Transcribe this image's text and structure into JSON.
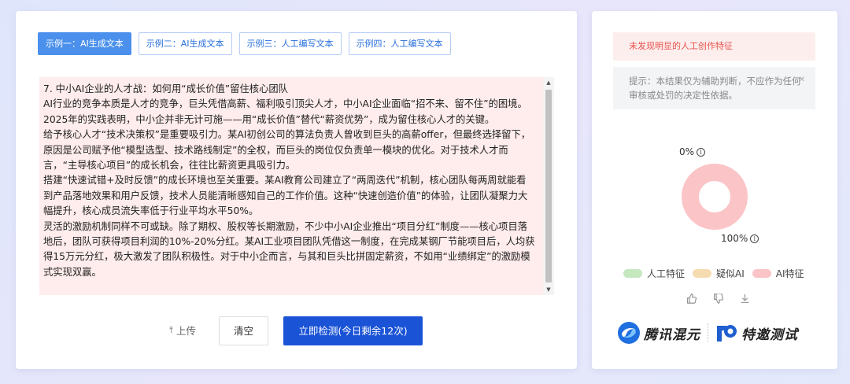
{
  "tabs": [
    {
      "label": "示例一：AI生成文本",
      "active": true
    },
    {
      "label": "示例二：AI生成文本",
      "active": false
    },
    {
      "label": "示例三：人工编写文本",
      "active": false
    },
    {
      "label": "示例四：人工编写文本",
      "active": false
    }
  ],
  "textarea": {
    "content": "7. 中小AI企业的人才战：如何用“成长价值”留住核心团队\nAI行业的竞争本质是人才的竞争，巨头凭借高薪、福利吸引顶尖人才，中小AI企业面临“招不来、留不住”的困境。2025年的实践表明，中小企并非无计可施——用“成长价值”替代“薪资优势”，成为留住核心人才的关键。\n给予核心人才“技术决策权”是重要吸引力。某AI初创公司的算法负责人曾收到巨头的高薪offer，但最终选择留下，原因是公司赋予他“模型选型、技术路线制定”的全权，而巨头的岗位仅负责单一模块的优化。对于技术人才而言，“主导核心项目”的成长机会，往往比薪资更具吸引力。\n搭建“快速试错+及时反馈”的成长环境也至关重要。某AI教育公司建立了“两周迭代”机制，核心团队每两周就能看到产品落地效果和用户反馈，技术人员能清晰感知自己的工作价值。这种“快速创造价值”的体验，让团队凝聚力大幅提升，核心成员流失率低于行业平均水平50%。\n灵活的激励机制同样不可或缺。除了期权、股权等长期激励，不少中小AI企业推出“项目分红”制度——核心项目落地后，团队可获得项目利润的10%-20%分红。某AI工业项目团队凭借这一制度，在完成某钢厂节能项目后，人均获得15万元分红，极大激发了团队积极性。对于中小企而言，与其和巨头比拼固定薪资，不如用“业绩绑定”的激励模式实现双赢。"
  },
  "actions": {
    "upload_label": "上传",
    "clear_label": "清空",
    "detect_label": "立即检测(今日剩余12次)"
  },
  "result": {
    "status_text": "未发现明显的人工创作特征",
    "tip_text": "提示：本结果仅为辅助判断，不应作为任何审核或处罚的决定性依据。"
  },
  "chart_data": {
    "type": "pie",
    "categories": [
      "人工特征",
      "疑似AI",
      "AI特征"
    ],
    "values": [
      0,
      0,
      100
    ],
    "labels": [
      "0%",
      "100%"
    ],
    "colors": [
      "#c5e8bf",
      "#f5dcb0",
      "#fbc4c6"
    ]
  },
  "legend": [
    {
      "label": "人工特征",
      "color": "#c5e8bf"
    },
    {
      "label": "疑似AI",
      "color": "#f5dcb0"
    },
    {
      "label": "AI特征",
      "color": "#fbc4c6"
    }
  ],
  "logos": {
    "hunyuan": "腾讯混元",
    "invite": "特邀测试"
  }
}
